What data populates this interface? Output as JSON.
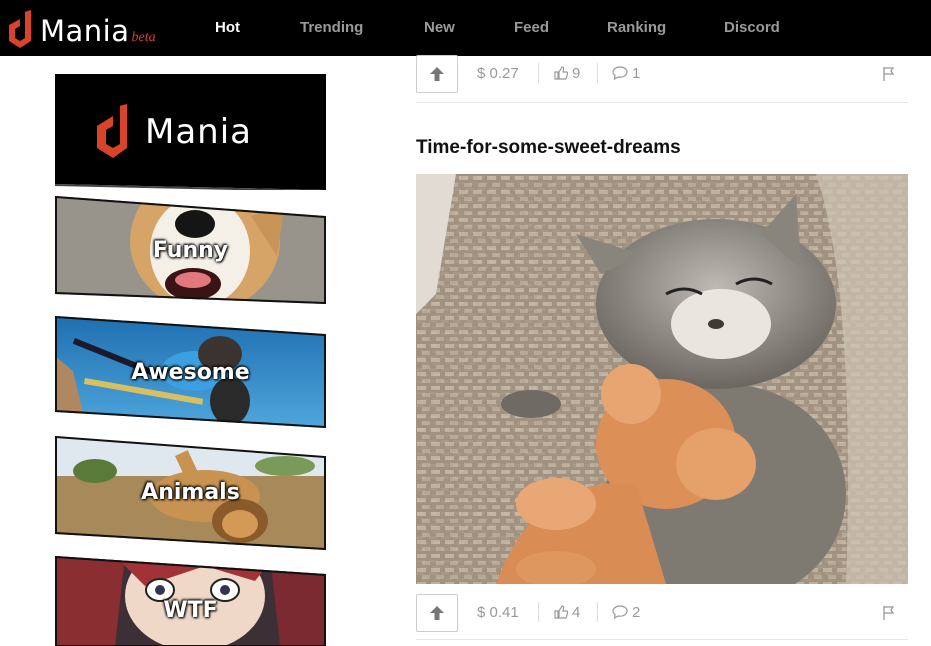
{
  "brand": {
    "name": "Mania",
    "tag": "beta",
    "accent": "#d9432a"
  },
  "nav": [
    {
      "label": "Hot",
      "active": true
    },
    {
      "label": "Trending"
    },
    {
      "label": "New"
    },
    {
      "label": "Feed"
    },
    {
      "label": "Ranking"
    },
    {
      "label": "Discord"
    }
  ],
  "sidebar": {
    "logo_text": "Mania",
    "categories": [
      {
        "label": "Funny"
      },
      {
        "label": "Awesome"
      },
      {
        "label": "Animals"
      },
      {
        "label": "WTF"
      }
    ]
  },
  "posts": [
    {
      "reward": "$ 0.27",
      "likes": "9",
      "comments": "1"
    },
    {
      "title": "Time-for-some-sweet-dreams",
      "reward": "$ 0.41",
      "likes": "4",
      "comments": "2"
    }
  ],
  "icons": {
    "upvote": "arrow-up-icon",
    "like": "thumbs-up-icon",
    "comment": "comment-bubble-icon",
    "flag": "flag-icon"
  }
}
